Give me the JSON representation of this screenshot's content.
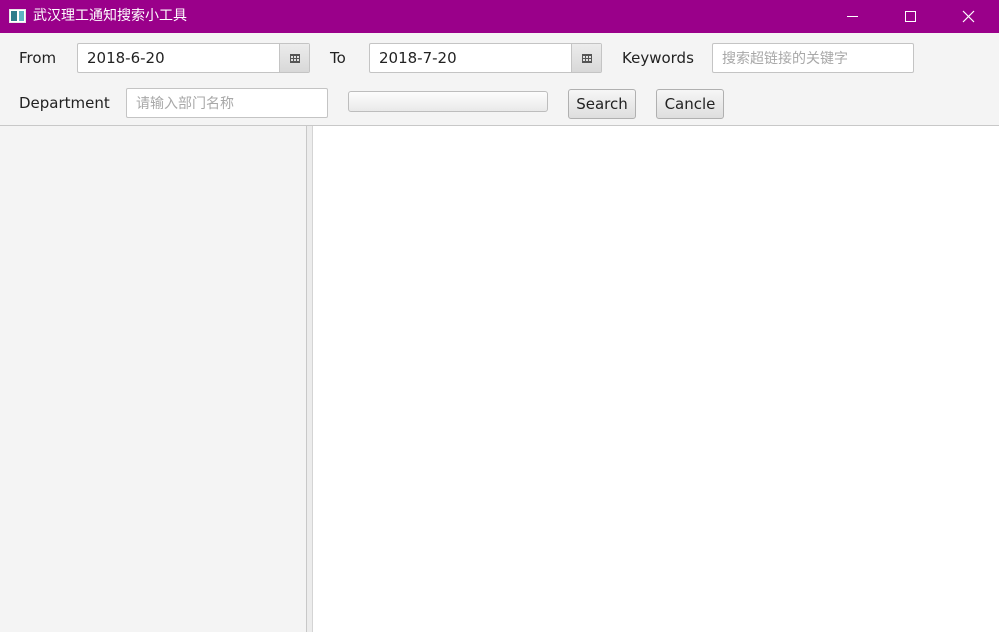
{
  "window": {
    "title": "武汉理工通知搜索小工具",
    "app_icon": "window-app-icon",
    "controls": [
      "minimize-icon",
      "maximize-icon",
      "close-icon"
    ],
    "titlebar_color": "#9a008a"
  },
  "form": {
    "from_label": "From",
    "from_value": "2018-6-20",
    "to_label": "To",
    "to_value": "2018-7-20",
    "keywords_label": "Keywords",
    "keywords_placeholder": "搜索超链接的关键字",
    "department_label": "Department",
    "department_placeholder": "请输入部门名称",
    "progress": 0,
    "search_label": "Search",
    "cancel_label": "Cancle",
    "calendar_icon": "calendar-icon"
  }
}
